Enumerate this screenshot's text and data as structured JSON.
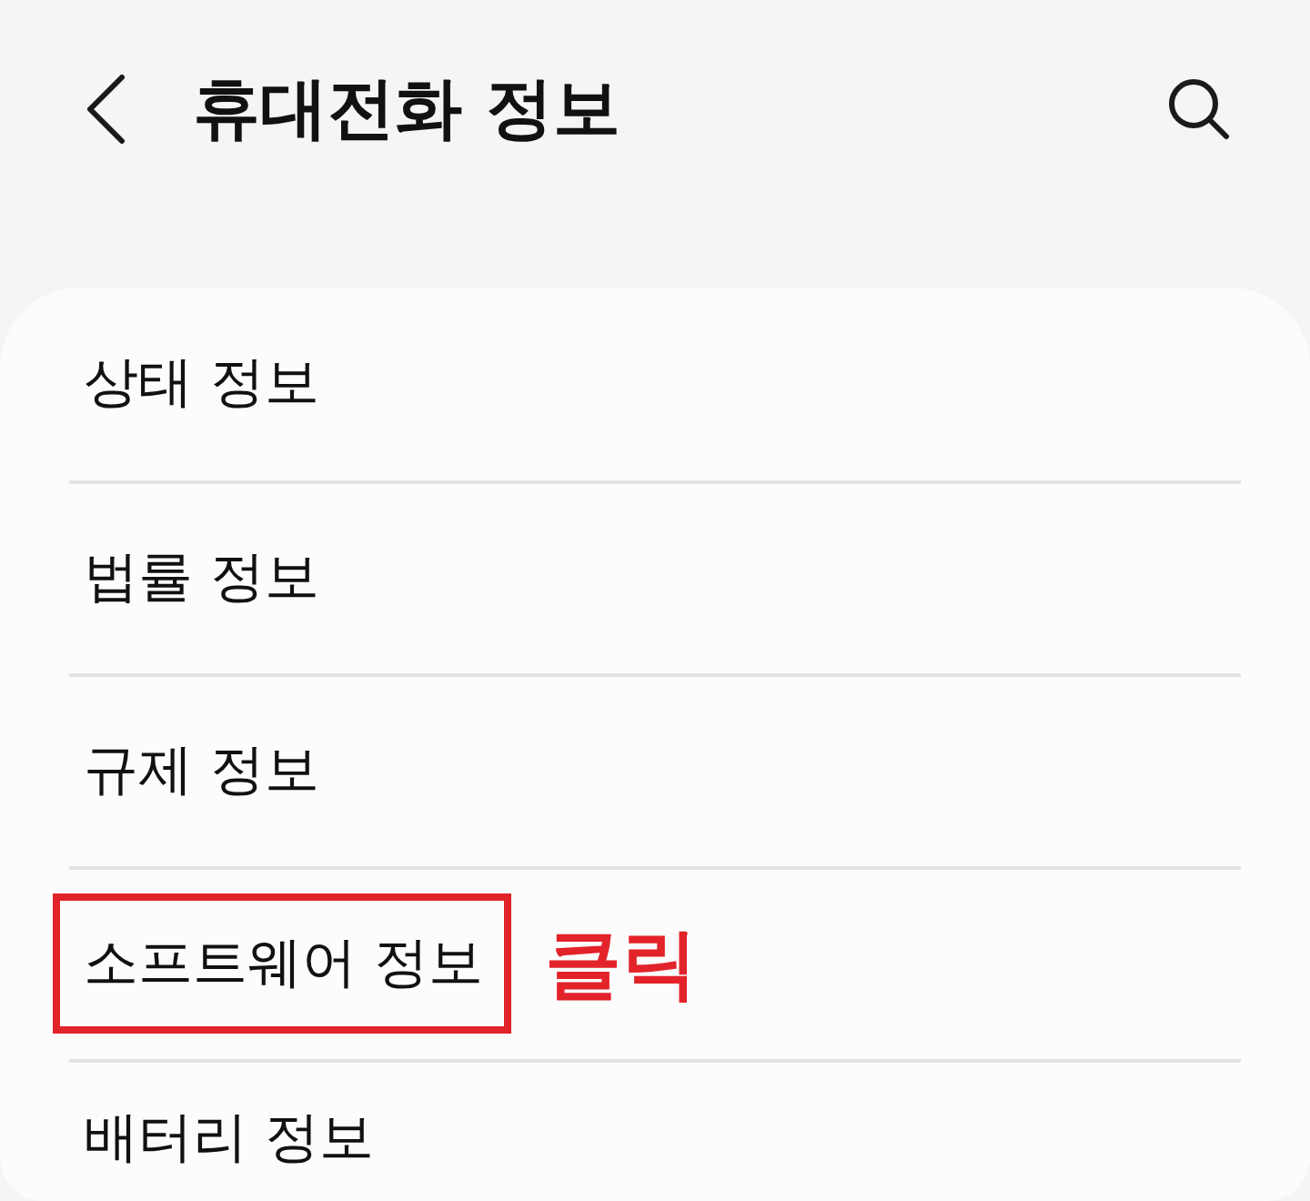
{
  "header": {
    "title": "휴대전화 정보"
  },
  "menu": {
    "items": [
      {
        "label": "상태 정보",
        "highlighted": false
      },
      {
        "label": "법률 정보",
        "highlighted": false
      },
      {
        "label": "규제 정보",
        "highlighted": false
      },
      {
        "label": "소프트웨어 정보",
        "highlighted": true,
        "callout": "클릭"
      },
      {
        "label": "배터리 정보",
        "highlighted": false
      }
    ]
  }
}
